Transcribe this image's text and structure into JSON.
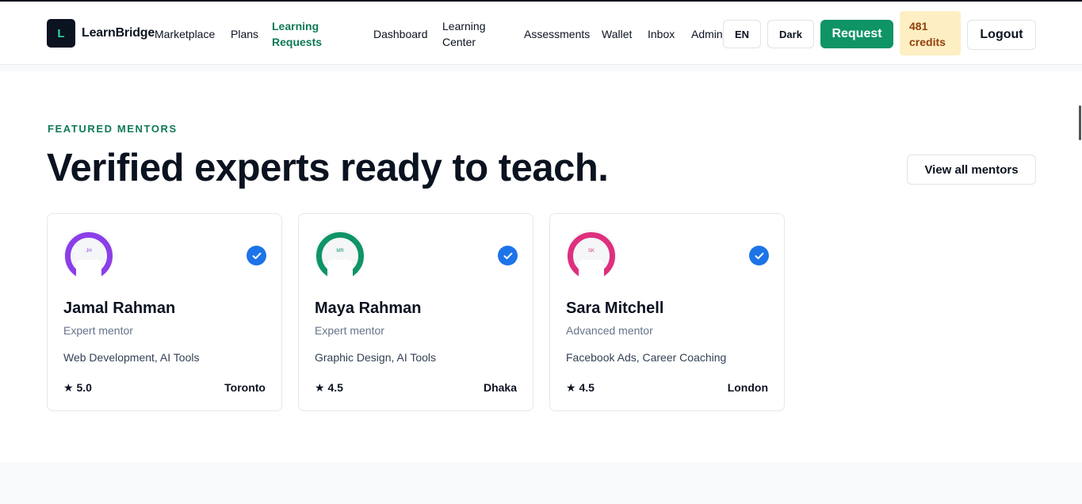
{
  "header": {
    "logo_letter": "L",
    "brand": "LearnBridge",
    "nav": [
      {
        "label": "Marketplace"
      },
      {
        "label": "Plans"
      },
      {
        "label": "Learning Requests"
      },
      {
        "label": "Dashboard"
      },
      {
        "label": "Learning Center"
      },
      {
        "label": "Assessments"
      },
      {
        "label": "Wallet"
      },
      {
        "label": "Inbox"
      },
      {
        "label": "Admin"
      }
    ],
    "active_nav": "Learning Requests",
    "lang_button": "EN",
    "theme_button": "Dark",
    "request_button": "Request",
    "credits_amount": "481",
    "credits_label": "credits",
    "logout_button": "Logout"
  },
  "section": {
    "eyebrow": "FEATURED MENTORS",
    "headline": "Verified experts ready to teach.",
    "view_all_button": "View all mentors"
  },
  "mentors": [
    {
      "initials": "JH",
      "name": "Jamal Rahman",
      "level": "Expert mentor",
      "skills": "Web Development, AI Tools",
      "rating": "★ 5.0",
      "city": "Toronto",
      "color": "#8b3ee8"
    },
    {
      "initials": "MR",
      "name": "Maya Rahman",
      "level": "Expert mentor",
      "skills": "Graphic Design, AI Tools",
      "rating": "★ 4.5",
      "city": "Dhaka",
      "color": "#0f9466"
    },
    {
      "initials": "SK",
      "name": "Sara Mitchell",
      "level": "Advanced mentor",
      "skills": "Facebook Ads, Career Coaching",
      "rating": "★ 4.5",
      "city": "London",
      "color": "#de2f7d"
    }
  ],
  "colors": {
    "accent": "#0f9466",
    "verified": "#1d74e8",
    "credits_bg": "#fdefc3",
    "credits_text": "#92400e"
  }
}
